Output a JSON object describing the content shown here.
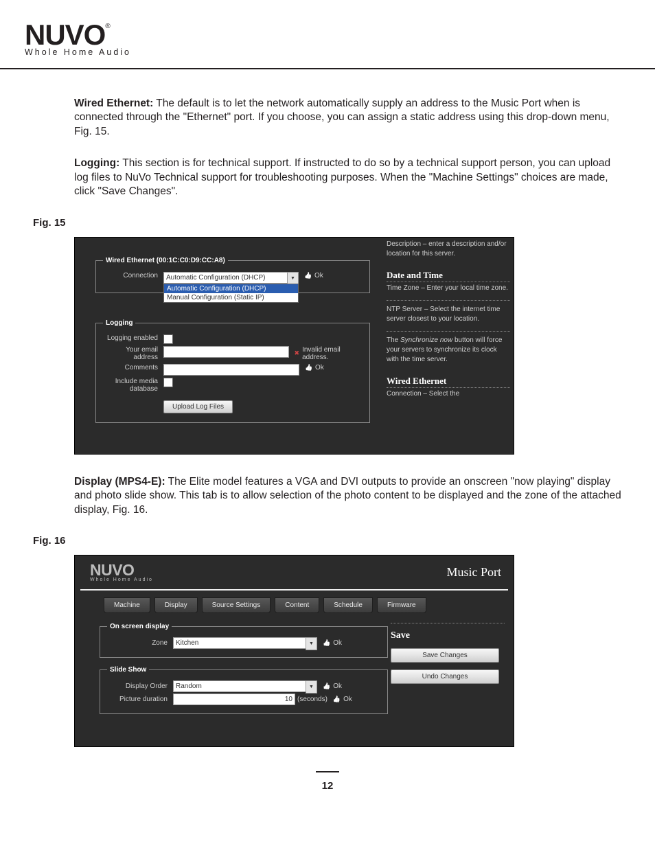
{
  "logo": {
    "main": "NUVO",
    "reg": "®",
    "sub": "Whole Home Audio"
  },
  "para1": {
    "bold": "Wired Ethernet:",
    "text": "  The default is to let the network automatically supply an address to the Music Port when is connected through the \"Ethernet\" port. If you choose, you can assign a static address using this drop-down menu, Fig. 15."
  },
  "para2": {
    "bold": "Logging:",
    "text": "  This section is for technical support. If instructed to do so by a technical support person, you can upload log files to NuVo Technical support for troubleshooting purposes. When the \"Machine Settings\" choices are made, click  \"Save Changes\"."
  },
  "fig15_label": "Fig. 15",
  "fig15": {
    "wired_legend": "Wired Ethernet (00:1C:C0:D9:CC:A8)",
    "conn_label": "Connection",
    "conn_value": "Automatic Configuration (DHCP)",
    "conn_opts": [
      "Automatic Configuration (DHCP)",
      "Manual Configuration (Static IP)"
    ],
    "ok": "Ok",
    "logging_legend": "Logging",
    "logging_enabled": "Logging enabled",
    "email_label": "Your email address",
    "email_status": "Invalid email address.",
    "comments_label": "Comments",
    "include_label": "Include media database",
    "upload_btn": "Upload Log Files",
    "side": {
      "desc": "Description – enter a description and/or location for this server.",
      "dt_head": "Date and Time",
      "tz": "Time Zone – Enter your local time zone.",
      "ntp": "NTP Server – Select the internet time server closest to your location.",
      "sync1": "The ",
      "sync_i": "Synchronize now",
      "sync2": " button will force your servers to synchronize its clock with the time server.",
      "we_head": "Wired Ethernet",
      "we_sub": "Connection – Select the"
    }
  },
  "para3": {
    "bold": "Display  (MPS4-E):",
    "text": "  The Elite model features a VGA and DVI outputs to provide an onscreen \"now playing\" display and photo slide show. This tab is to allow selection of the photo content to be displayed and the zone of the attached display, Fig. 16."
  },
  "fig16_label": "Fig. 16",
  "fig16": {
    "logo_main": "NUVO",
    "logo_sub": "Whole Home Audio",
    "app_title": "Music Port",
    "tabs": [
      "Machine",
      "Display",
      "Source Settings",
      "Content",
      "Schedule",
      "Firmware"
    ],
    "osd_legend": "On screen display",
    "zone_label": "Zone",
    "zone_value": "Kitchen",
    "ok": "Ok",
    "slide_legend": "Slide Show",
    "display_order_label": "Display Order",
    "display_order_value": "Random",
    "picture_duration_label": "Picture duration",
    "picture_duration_value": "10",
    "seconds": "(seconds)",
    "save_head": "Save",
    "save_btn": "Save Changes",
    "undo_btn": "Undo Changes"
  },
  "page_number": "12"
}
